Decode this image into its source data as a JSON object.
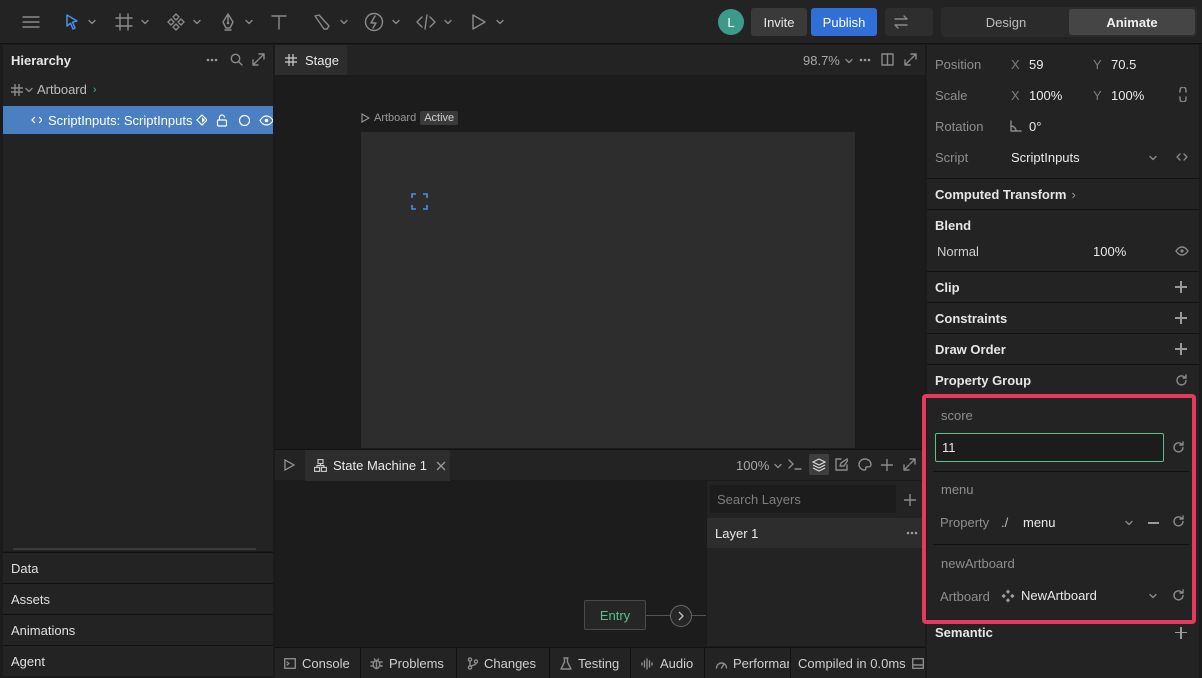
{
  "toolbar": {
    "avatar_letter": "L",
    "invite_label": "Invite",
    "publish_label": "Publish",
    "mode_tabs": [
      "Design",
      "Animate"
    ],
    "active_mode": "Animate"
  },
  "hierarchy": {
    "title": "Hierarchy",
    "artboard_label": "Artboard",
    "item_label": "ScriptInputs: ScriptInputs"
  },
  "left_panels": [
    "Data",
    "Assets",
    "Animations",
    "Agent"
  ],
  "stage": {
    "tab_label": "Stage",
    "zoom": "98.7%",
    "artboard_label": "Artboard",
    "artboard_badge": "Active"
  },
  "state_machine": {
    "tab_label": "State Machine 1",
    "zoom": "100%",
    "search_placeholder": "Search Layers",
    "layer_label": "Layer 1",
    "entry_label": "Entry"
  },
  "bottom_tabs": [
    "Console",
    "Problems",
    "Changes",
    "Testing",
    "Audio",
    "Performan"
  ],
  "status_text": "Compiled in 0.0ms",
  "inspector": {
    "position_label": "Position",
    "pos_x_label": "X",
    "pos_x": "59",
    "pos_y_label": "Y",
    "pos_y": "70.5",
    "scale_label": "Scale",
    "scale_x_label": "X",
    "scale_x": "100%",
    "scale_y_label": "Y",
    "scale_y": "100%",
    "rotation_label": "Rotation",
    "rotation": "0°",
    "script_label": "Script",
    "script_value": "ScriptInputs",
    "computed_transform": "Computed Transform",
    "blend_title": "Blend",
    "blend_mode": "Normal",
    "blend_opacity": "100%",
    "sections": [
      "Clip",
      "Constraints",
      "Draw Order"
    ],
    "property_group": "Property Group",
    "score_label": "score",
    "score_value": "11",
    "menu_label": "menu",
    "property_label": "Property",
    "property_path": "./",
    "property_value": "menu",
    "new_artboard_label": "newArtboard",
    "artboard_field_label": "Artboard",
    "artboard_value": "NewArtboard",
    "semantic": "Semantic"
  },
  "colors": {
    "accent": "#2f6fd6",
    "highlight": "#e5395f",
    "selection": "#4a7fc1",
    "avatar": "#3d9a8b"
  }
}
